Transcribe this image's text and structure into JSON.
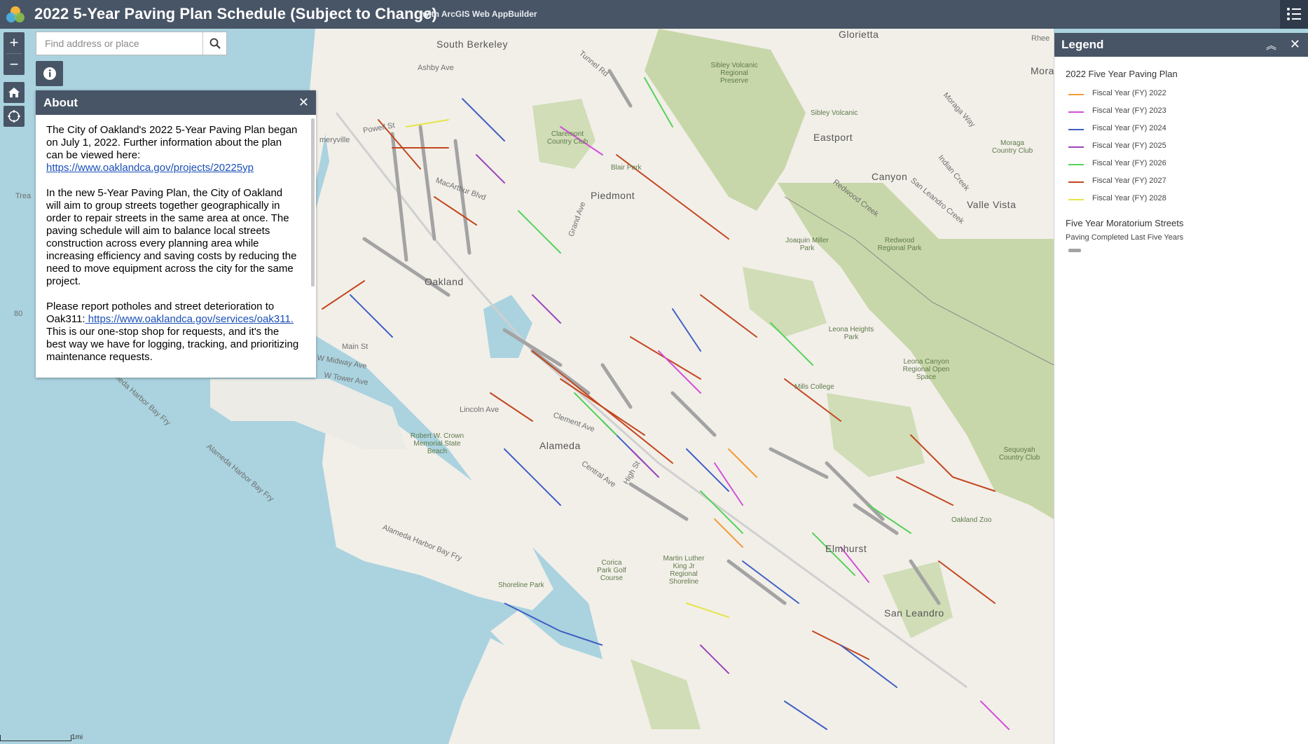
{
  "header": {
    "title": "2022 5-Year Paving Plan Schedule (Subject to Change)",
    "subtitle": "with ArcGIS Web AppBuilder"
  },
  "search": {
    "placeholder": "Find address or place"
  },
  "about": {
    "title": "About",
    "p1": "The City of Oakland's 2022 5-Year Paving Plan began on July 1, 2022. Further information about the plan can be viewed here: ",
    "p1_link": "https://www.oaklandca.gov/projects/20225yp",
    "p2": "In the new 5-Year Paving Plan, the City of Oakland will aim to group streets together geographically in order to repair streets in the same area at once. The paving schedule will aim to balance local streets construction across every planning area while increasing efficiency and saving costs by reducing the need to move equipment across the city for the same project.",
    "p3": "Please report potholes and street deterioration to Oak311:",
    "p3_link": " https://www.oaklandca.gov/services/oak311.",
    "p3_rest": " This is our one-stop shop for requests, and it's the best way we have for logging, tracking, and prioritizing maintenance requests."
  },
  "legend": {
    "title": "Legend",
    "section1": "2022 Five Year Paving Plan",
    "items": [
      {
        "label": "Fiscal Year (FY) 2022",
        "color": "#f39c33"
      },
      {
        "label": "Fiscal Year (FY) 2023",
        "color": "#d24fd8"
      },
      {
        "label": "Fiscal Year (FY) 2024",
        "color": "#3f5fc4"
      },
      {
        "label": "Fiscal Year (FY) 2025",
        "color": "#9b45b8"
      },
      {
        "label": "Fiscal Year (FY) 2026",
        "color": "#56d25a"
      },
      {
        "label": "Fiscal Year (FY) 2027",
        "color": "#c4461e"
      },
      {
        "label": "Fiscal Year (FY) 2028",
        "color": "#e5e547"
      }
    ],
    "section2": "Five Year Moratorium Streets",
    "moratorium_label": "Paving Completed Last Five Years",
    "moratorium_color": "#a3a3a3"
  },
  "map": {
    "labels": {
      "south_berkeley": "South Berkeley",
      "piedmont": "Piedmont",
      "oakland": "Oakland",
      "alameda": "Alameda",
      "san_leandro": "San Leandro",
      "canyon": "Canyon",
      "eastport": "Eastport",
      "valle_vista": "Valle Vista",
      "glorietta": "Glorietta",
      "emeryville": "meryville",
      "moraga": "Moraga",
      "rheem": "Rhee",
      "elmhurst": "Elmhurst",
      "treasure": "Trea",
      "sibley": "Sibley Volcanic Regional Preserve",
      "sibley2": "Sibley Volcanic",
      "claremont": "Claremont Country Club",
      "blair": "Blair Park",
      "joaquin": "Joaquin Miller Park",
      "redwood": "Redwood Regional Park",
      "leona_heights": "Leona Heights Park",
      "leona_canyon": "Leona Canyon Regional Open Space",
      "mills": "Mills College",
      "robert": "Robert W. Crown Memorial State Beach",
      "moraga_cc": "Moraga Country Club",
      "oakland_zoo": "Oakland Zoo",
      "sequoyah": "Sequoyah Country Club",
      "corica": "Corica Park Golf Course",
      "mlk": "Martin Luther King Jr Regional Shoreline",
      "shoreline": "Shoreline Park",
      "alameda_harbor": "Alameda Harbor Bay Fry",
      "alameda_harbor2": "Alameda Harbor Bay Fry",
      "alameda_harbor3": "Alameda Harbor Bay Fry",
      "redwood_creek": "Redwood Creek",
      "san_leandro_creek": "San Leandro Creek",
      "indian_creek": "Indian Creek",
      "moraga_way": "Moraga Way",
      "ashby": "Ashby Ave",
      "tunnel": "Tunnel Rd",
      "powell": "Powell St",
      "grand": "Grand Ave",
      "mcarthur": "MacArthur Blvd",
      "lincoln": "Lincoln Ave",
      "clement": "Clement Ave",
      "central": "Central Ave",
      "high": "High St",
      "hwy80": "80",
      "main_st": "Main St",
      "midway": "W Midway Ave",
      "tower": "W Tower Ave",
      "scale": "1mi"
    }
  }
}
